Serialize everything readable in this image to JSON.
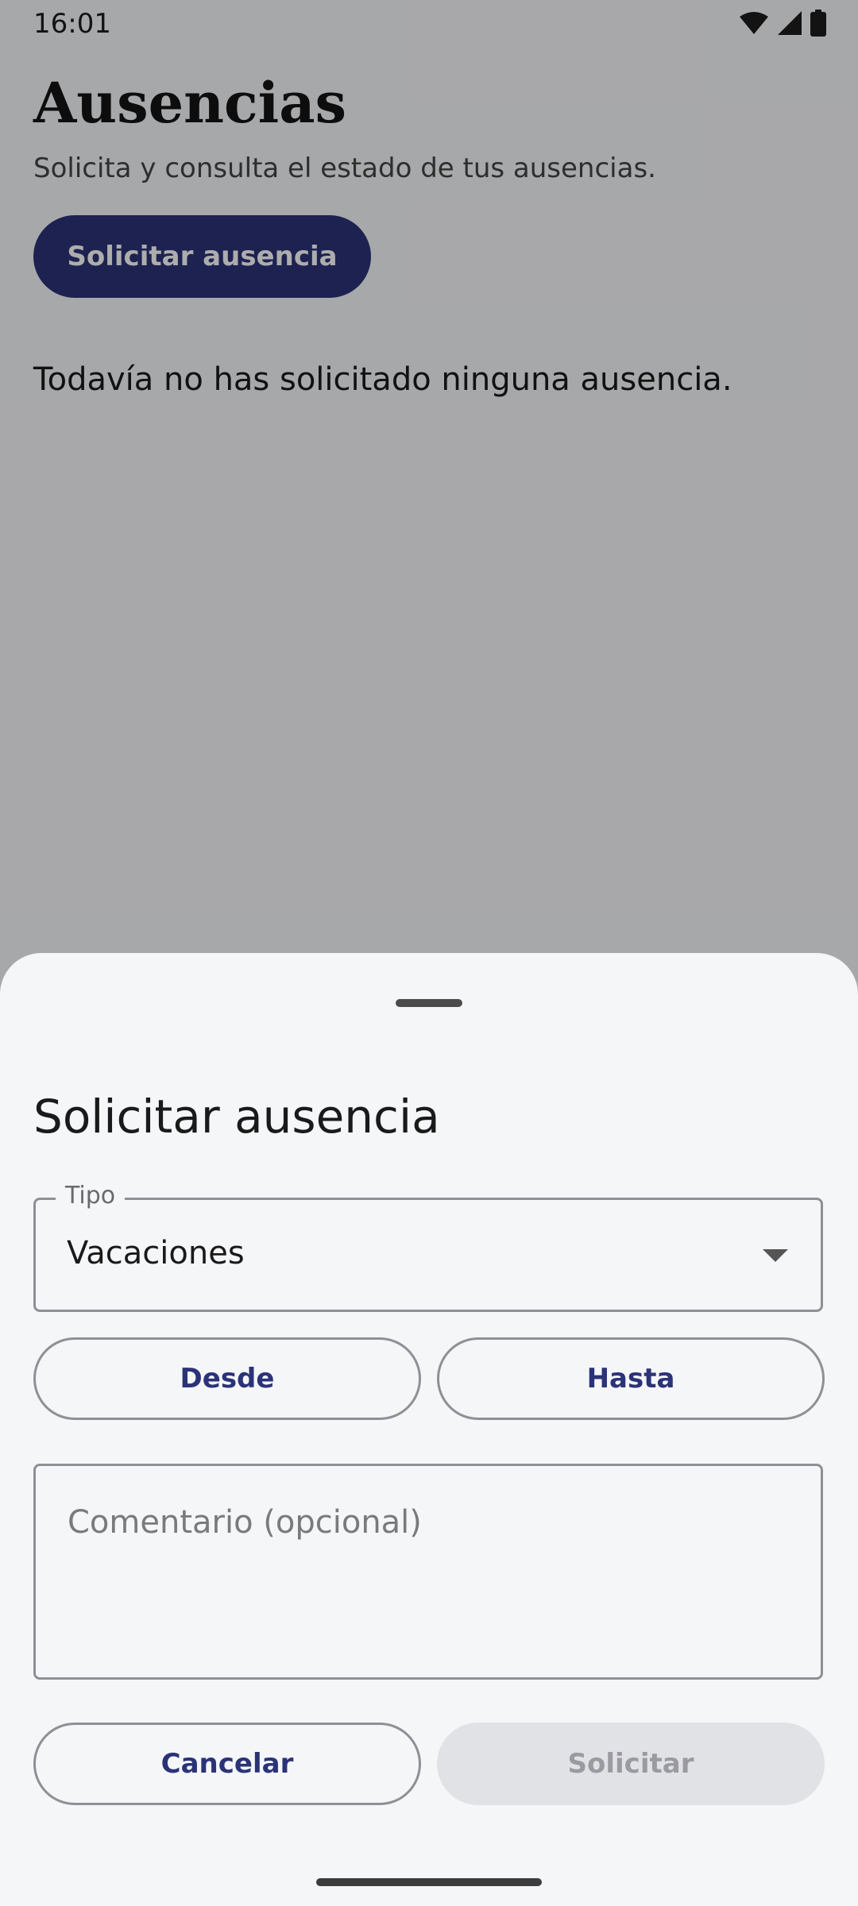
{
  "status_bar": {
    "time": "16:01"
  },
  "page": {
    "title": "Ausencias",
    "subtitle": "Solicita y consulta el estado de tus ausencias.",
    "request_button_label": "Solicitar ausencia",
    "empty_message": "Todavía no has solicitado ninguna ausencia."
  },
  "sheet": {
    "title": "Solicitar ausencia",
    "type_field": {
      "label": "Tipo",
      "value": "Vacaciones"
    },
    "from_button_label": "Desde",
    "to_button_label": "Hasta",
    "comment_placeholder": "Comentario (opcional)",
    "cancel_label": "Cancelar",
    "submit_label": "Solicitar"
  },
  "colors": {
    "primary": "#2b3378",
    "scrim": "rgba(0,0,0,0.32)",
    "disabled_bg": "#e1e2e6"
  },
  "icons": [
    "wifi-icon",
    "signal-icon",
    "battery-icon",
    "dropdown-arrow-icon"
  ]
}
